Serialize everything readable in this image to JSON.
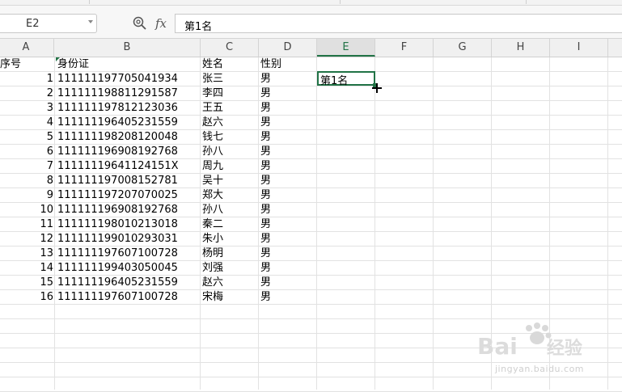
{
  "formula_bar": {
    "cell_ref": "E2",
    "fx_label": "fx",
    "formula_value": "第1名"
  },
  "columns": [
    "A",
    "B",
    "C",
    "D",
    "E",
    "F",
    "G",
    "H",
    "I"
  ],
  "active_column": "E",
  "rows": [
    {
      "a": "序号",
      "b": "身份证",
      "c": "姓名",
      "d": "性别"
    },
    {
      "a": "1",
      "b": "111111197705041934",
      "c": "张三",
      "d": "男"
    },
    {
      "a": "2",
      "b": "111111198811291587",
      "c": "李四",
      "d": "男"
    },
    {
      "a": "3",
      "b": "111111197812123036",
      "c": "王五",
      "d": "男"
    },
    {
      "a": "4",
      "b": "111111196405231559",
      "c": "赵六",
      "d": "男"
    },
    {
      "a": "5",
      "b": "111111198208120048",
      "c": "钱七",
      "d": "男"
    },
    {
      "a": "6",
      "b": "111111196908192768",
      "c": "孙八",
      "d": "男"
    },
    {
      "a": "7",
      "b": "11111119641124151X",
      "c": "周九",
      "d": "男"
    },
    {
      "a": "8",
      "b": "111111197008152781",
      "c": "吴十",
      "d": "男"
    },
    {
      "a": "9",
      "b": "111111197207070025",
      "c": "郑大",
      "d": "男"
    },
    {
      "a": "10",
      "b": "111111196908192768",
      "c": "孙八",
      "d": "男"
    },
    {
      "a": "11",
      "b": "111111198010213018",
      "c": "秦二",
      "d": "男"
    },
    {
      "a": "12",
      "b": "111111199010293031",
      "c": "朱小",
      "d": "男"
    },
    {
      "a": "13",
      "b": "111111197607100728",
      "c": "杨明",
      "d": "男"
    },
    {
      "a": "14",
      "b": "111111199403050045",
      "c": "刘强",
      "d": "男"
    },
    {
      "a": "15",
      "b": "111111196405231559",
      "c": "赵六",
      "d": "男"
    },
    {
      "a": "16",
      "b": "111111197607100728",
      "c": "宋梅",
      "d": "男"
    }
  ],
  "selected_cell_value": "第1名",
  "watermark": {
    "brand": "Bai",
    "brand2": "经验",
    "url": "jingyan.baidu.com"
  },
  "colors": {
    "accent": "#217346",
    "grid_line": "#e2e2e2",
    "header_bg": "#f0f0f0"
  }
}
